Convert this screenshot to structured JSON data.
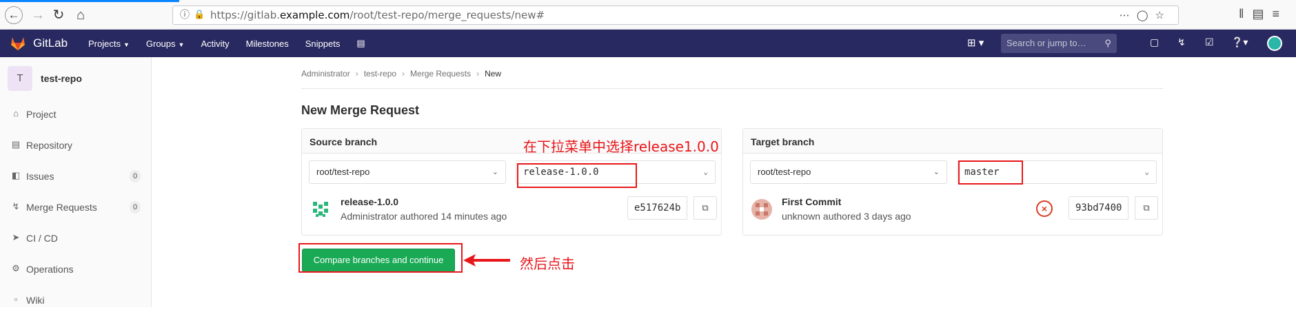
{
  "browser": {
    "url_prefix": "https://gitlab.",
    "url_domain": "example.com",
    "url_path": "/root/test-repo/merge_requests/new#"
  },
  "header": {
    "brand": "GitLab",
    "nav": [
      {
        "label": "Projects",
        "dropdown": true
      },
      {
        "label": "Groups",
        "dropdown": true
      },
      {
        "label": "Activity",
        "dropdown": false
      },
      {
        "label": "Milestones",
        "dropdown": false
      },
      {
        "label": "Snippets",
        "dropdown": false
      }
    ],
    "search_placeholder": "Search or jump to…",
    "bg_color": "#292961"
  },
  "sidebar": {
    "project_letter": "T",
    "project_name": "test-repo",
    "items": [
      {
        "label": "Project",
        "icon": "home-icon",
        "count": null
      },
      {
        "label": "Repository",
        "icon": "book-icon",
        "count": null
      },
      {
        "label": "Issues",
        "icon": "issues-icon",
        "count": "0"
      },
      {
        "label": "Merge Requests",
        "icon": "merge-request-icon",
        "count": "0"
      },
      {
        "label": "CI / CD",
        "icon": "rocket-icon",
        "count": null
      },
      {
        "label": "Operations",
        "icon": "cloud-gear-icon",
        "count": null
      },
      {
        "label": "Wiki",
        "icon": "book-open-icon",
        "count": null
      }
    ]
  },
  "breadcrumb": [
    "Administrator",
    "test-repo",
    "Merge Requests",
    "New"
  ],
  "page_title": "New Merge Request",
  "source": {
    "title": "Source branch",
    "project": "root/test-repo",
    "branch": "release-1.0.0",
    "commit_title": "release-1.0.0",
    "commit_sub": "Administrator authored 14 minutes ago",
    "sha": "e517624b"
  },
  "target": {
    "title": "Target branch",
    "project": "root/test-repo",
    "branch": "master",
    "commit_title": "First Commit",
    "commit_sub": "unknown authored 3 days ago",
    "sha": "93bd7400"
  },
  "compare_button": "Compare branches and continue",
  "annotations": {
    "select_hint": "在下拉菜单中选择release1.0.0",
    "click_hint": "然后点击",
    "color": "#e8161a"
  },
  "accent_green": "#1aaa55"
}
